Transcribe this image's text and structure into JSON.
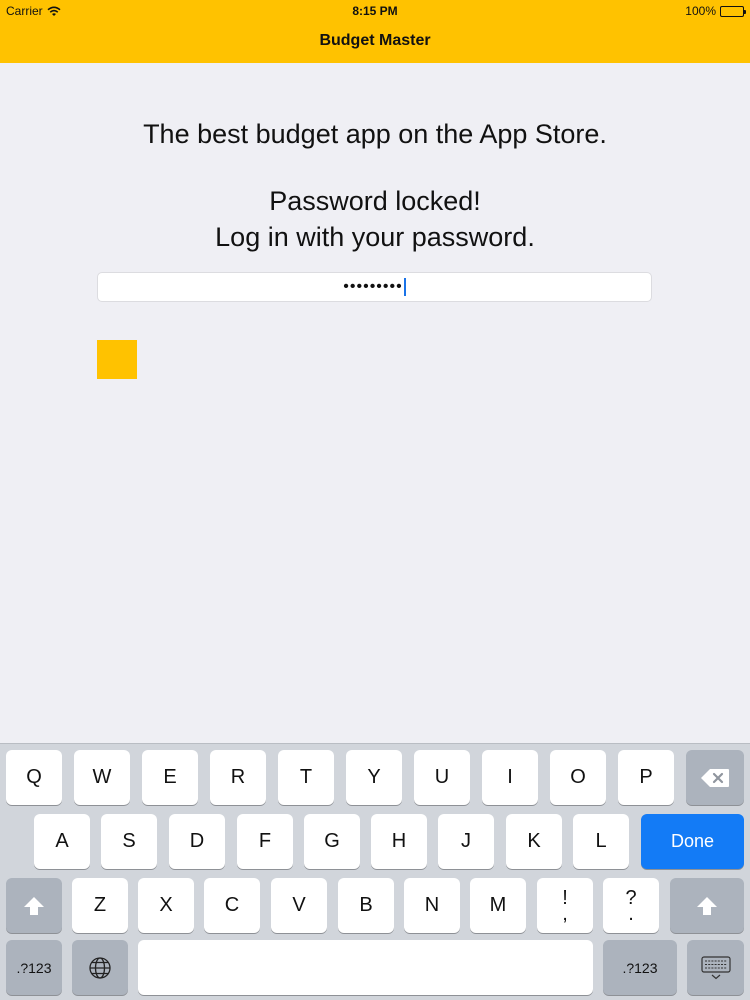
{
  "status_bar": {
    "carrier": "Carrier",
    "time": "8:15 PM",
    "battery": "100%"
  },
  "nav": {
    "title": "Budget Master"
  },
  "main": {
    "tagline": "The best budget app on the App Store.",
    "locked_line1": "Password locked!",
    "locked_line2": "Log in with your password.",
    "password_value": "•••••••••"
  },
  "keyboard": {
    "row1": [
      "Q",
      "W",
      "E",
      "R",
      "T",
      "Y",
      "U",
      "I",
      "O",
      "P"
    ],
    "row2": [
      "A",
      "S",
      "D",
      "F",
      "G",
      "H",
      "J",
      "K",
      "L"
    ],
    "row3": [
      "Z",
      "X",
      "C",
      "V",
      "B",
      "N",
      "M"
    ],
    "done_label": "Done",
    "numbers_label": ".?123",
    "punct1_top": "!",
    "punct1_bottom": ",",
    "punct2_top": "?",
    "punct2_bottom": "."
  },
  "colors": {
    "accent": "#ffc200",
    "done_blue": "#137bf6"
  },
  "icons": [
    "wifi-icon",
    "battery-icon",
    "backspace-icon",
    "shift-icon",
    "globe-icon",
    "keyboard-dismiss-icon"
  ]
}
